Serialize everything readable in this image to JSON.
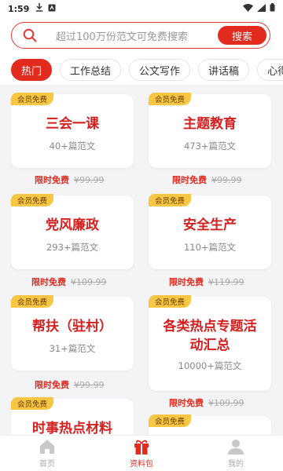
{
  "status": {
    "time": "1:59"
  },
  "search": {
    "placeholder": "超过100万份范文可免费搜索",
    "button_label": "搜索"
  },
  "tabs": [
    {
      "label": "热门",
      "active": true
    },
    {
      "label": "工作总结"
    },
    {
      "label": "公文写作"
    },
    {
      "label": "讲话稿"
    },
    {
      "label": "心得"
    }
  ],
  "cards": [
    {
      "badge": "会员免费",
      "title": "三会一课",
      "count": "40+篇范文",
      "free_label": "限时免费",
      "orig_price": "¥99.99"
    },
    {
      "badge": "会员免费",
      "title": "主题教育",
      "count": "473+篇范文",
      "free_label": "限时免费",
      "orig_price": "¥99.99"
    },
    {
      "badge": "会员免费",
      "title": "党风廉政",
      "count": "293+篇范文",
      "free_label": "限时免费",
      "orig_price": "¥109.99"
    },
    {
      "badge": "会员免费",
      "title": "安全生产",
      "count": "110+篇范文",
      "free_label": "限时免费",
      "orig_price": "¥119.99"
    },
    {
      "badge": "会员免费",
      "title": "帮扶（驻村）",
      "count": "31+篇范文",
      "free_label": "限时免费",
      "orig_price": "¥99.99"
    },
    {
      "badge": "会员免费",
      "title": "各类热点专题活动汇总",
      "count": "10000+篇范文",
      "free_label": "限时免费",
      "orig_price": "¥109.99"
    },
    {
      "badge": "会员免费",
      "title": "时事热点材料"
    },
    {
      "badge": "会员免费"
    }
  ],
  "bottom_nav": [
    {
      "label": "首页",
      "icon": "home-icon"
    },
    {
      "label": "资料包",
      "icon": "gift-icon",
      "active": true
    },
    {
      "label": "我的",
      "icon": "user-icon"
    }
  ],
  "colors": {
    "accent": "#e22a1f",
    "badge": "#f7c744"
  }
}
